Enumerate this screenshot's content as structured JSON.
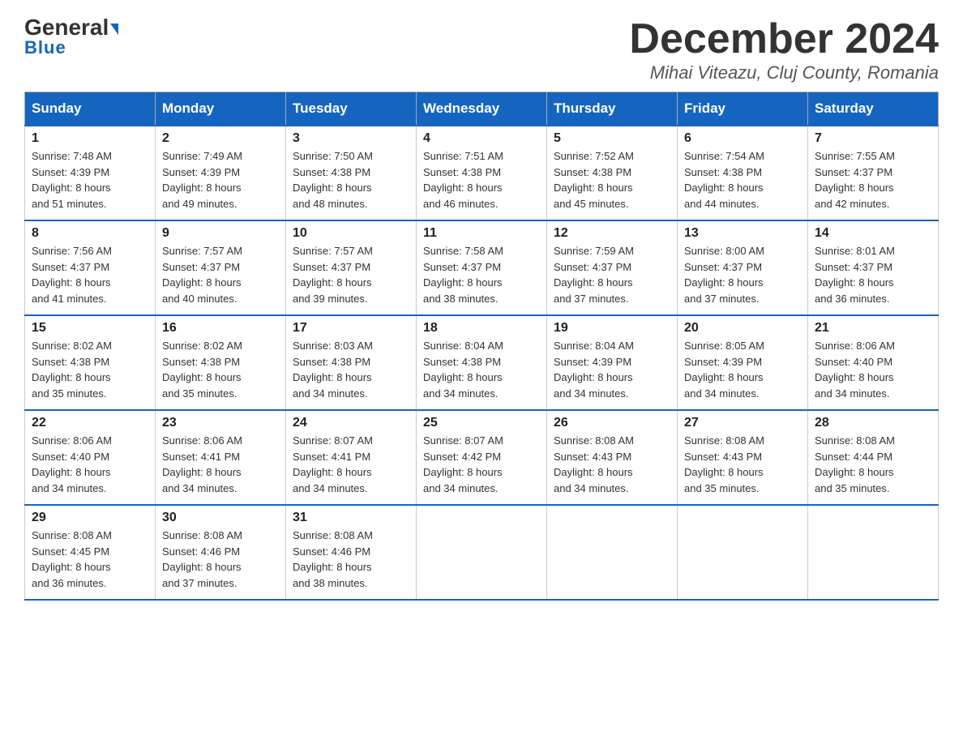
{
  "header": {
    "logo_general": "General",
    "logo_blue": "Blue",
    "title": "December 2024",
    "location": "Mihai Viteazu, Cluj County, Romania"
  },
  "days_of_week": [
    "Sunday",
    "Monday",
    "Tuesday",
    "Wednesday",
    "Thursday",
    "Friday",
    "Saturday"
  ],
  "weeks": [
    [
      {
        "day": "1",
        "sunrise": "Sunrise: 7:48 AM",
        "sunset": "Sunset: 4:39 PM",
        "daylight": "Daylight: 8 hours and 51 minutes."
      },
      {
        "day": "2",
        "sunrise": "Sunrise: 7:49 AM",
        "sunset": "Sunset: 4:39 PM",
        "daylight": "Daylight: 8 hours and 49 minutes."
      },
      {
        "day": "3",
        "sunrise": "Sunrise: 7:50 AM",
        "sunset": "Sunset: 4:38 PM",
        "daylight": "Daylight: 8 hours and 48 minutes."
      },
      {
        "day": "4",
        "sunrise": "Sunrise: 7:51 AM",
        "sunset": "Sunset: 4:38 PM",
        "daylight": "Daylight: 8 hours and 46 minutes."
      },
      {
        "day": "5",
        "sunrise": "Sunrise: 7:52 AM",
        "sunset": "Sunset: 4:38 PM",
        "daylight": "Daylight: 8 hours and 45 minutes."
      },
      {
        "day": "6",
        "sunrise": "Sunrise: 7:54 AM",
        "sunset": "Sunset: 4:38 PM",
        "daylight": "Daylight: 8 hours and 44 minutes."
      },
      {
        "day": "7",
        "sunrise": "Sunrise: 7:55 AM",
        "sunset": "Sunset: 4:37 PM",
        "daylight": "Daylight: 8 hours and 42 minutes."
      }
    ],
    [
      {
        "day": "8",
        "sunrise": "Sunrise: 7:56 AM",
        "sunset": "Sunset: 4:37 PM",
        "daylight": "Daylight: 8 hours and 41 minutes."
      },
      {
        "day": "9",
        "sunrise": "Sunrise: 7:57 AM",
        "sunset": "Sunset: 4:37 PM",
        "daylight": "Daylight: 8 hours and 40 minutes."
      },
      {
        "day": "10",
        "sunrise": "Sunrise: 7:57 AM",
        "sunset": "Sunset: 4:37 PM",
        "daylight": "Daylight: 8 hours and 39 minutes."
      },
      {
        "day": "11",
        "sunrise": "Sunrise: 7:58 AM",
        "sunset": "Sunset: 4:37 PM",
        "daylight": "Daylight: 8 hours and 38 minutes."
      },
      {
        "day": "12",
        "sunrise": "Sunrise: 7:59 AM",
        "sunset": "Sunset: 4:37 PM",
        "daylight": "Daylight: 8 hours and 37 minutes."
      },
      {
        "day": "13",
        "sunrise": "Sunrise: 8:00 AM",
        "sunset": "Sunset: 4:37 PM",
        "daylight": "Daylight: 8 hours and 37 minutes."
      },
      {
        "day": "14",
        "sunrise": "Sunrise: 8:01 AM",
        "sunset": "Sunset: 4:37 PM",
        "daylight": "Daylight: 8 hours and 36 minutes."
      }
    ],
    [
      {
        "day": "15",
        "sunrise": "Sunrise: 8:02 AM",
        "sunset": "Sunset: 4:38 PM",
        "daylight": "Daylight: 8 hours and 35 minutes."
      },
      {
        "day": "16",
        "sunrise": "Sunrise: 8:02 AM",
        "sunset": "Sunset: 4:38 PM",
        "daylight": "Daylight: 8 hours and 35 minutes."
      },
      {
        "day": "17",
        "sunrise": "Sunrise: 8:03 AM",
        "sunset": "Sunset: 4:38 PM",
        "daylight": "Daylight: 8 hours and 34 minutes."
      },
      {
        "day": "18",
        "sunrise": "Sunrise: 8:04 AM",
        "sunset": "Sunset: 4:38 PM",
        "daylight": "Daylight: 8 hours and 34 minutes."
      },
      {
        "day": "19",
        "sunrise": "Sunrise: 8:04 AM",
        "sunset": "Sunset: 4:39 PM",
        "daylight": "Daylight: 8 hours and 34 minutes."
      },
      {
        "day": "20",
        "sunrise": "Sunrise: 8:05 AM",
        "sunset": "Sunset: 4:39 PM",
        "daylight": "Daylight: 8 hours and 34 minutes."
      },
      {
        "day": "21",
        "sunrise": "Sunrise: 8:06 AM",
        "sunset": "Sunset: 4:40 PM",
        "daylight": "Daylight: 8 hours and 34 minutes."
      }
    ],
    [
      {
        "day": "22",
        "sunrise": "Sunrise: 8:06 AM",
        "sunset": "Sunset: 4:40 PM",
        "daylight": "Daylight: 8 hours and 34 minutes."
      },
      {
        "day": "23",
        "sunrise": "Sunrise: 8:06 AM",
        "sunset": "Sunset: 4:41 PM",
        "daylight": "Daylight: 8 hours and 34 minutes."
      },
      {
        "day": "24",
        "sunrise": "Sunrise: 8:07 AM",
        "sunset": "Sunset: 4:41 PM",
        "daylight": "Daylight: 8 hours and 34 minutes."
      },
      {
        "day": "25",
        "sunrise": "Sunrise: 8:07 AM",
        "sunset": "Sunset: 4:42 PM",
        "daylight": "Daylight: 8 hours and 34 minutes."
      },
      {
        "day": "26",
        "sunrise": "Sunrise: 8:08 AM",
        "sunset": "Sunset: 4:43 PM",
        "daylight": "Daylight: 8 hours and 34 minutes."
      },
      {
        "day": "27",
        "sunrise": "Sunrise: 8:08 AM",
        "sunset": "Sunset: 4:43 PM",
        "daylight": "Daylight: 8 hours and 35 minutes."
      },
      {
        "day": "28",
        "sunrise": "Sunrise: 8:08 AM",
        "sunset": "Sunset: 4:44 PM",
        "daylight": "Daylight: 8 hours and 35 minutes."
      }
    ],
    [
      {
        "day": "29",
        "sunrise": "Sunrise: 8:08 AM",
        "sunset": "Sunset: 4:45 PM",
        "daylight": "Daylight: 8 hours and 36 minutes."
      },
      {
        "day": "30",
        "sunrise": "Sunrise: 8:08 AM",
        "sunset": "Sunset: 4:46 PM",
        "daylight": "Daylight: 8 hours and 37 minutes."
      },
      {
        "day": "31",
        "sunrise": "Sunrise: 8:08 AM",
        "sunset": "Sunset: 4:46 PM",
        "daylight": "Daylight: 8 hours and 38 minutes."
      },
      null,
      null,
      null,
      null
    ]
  ]
}
